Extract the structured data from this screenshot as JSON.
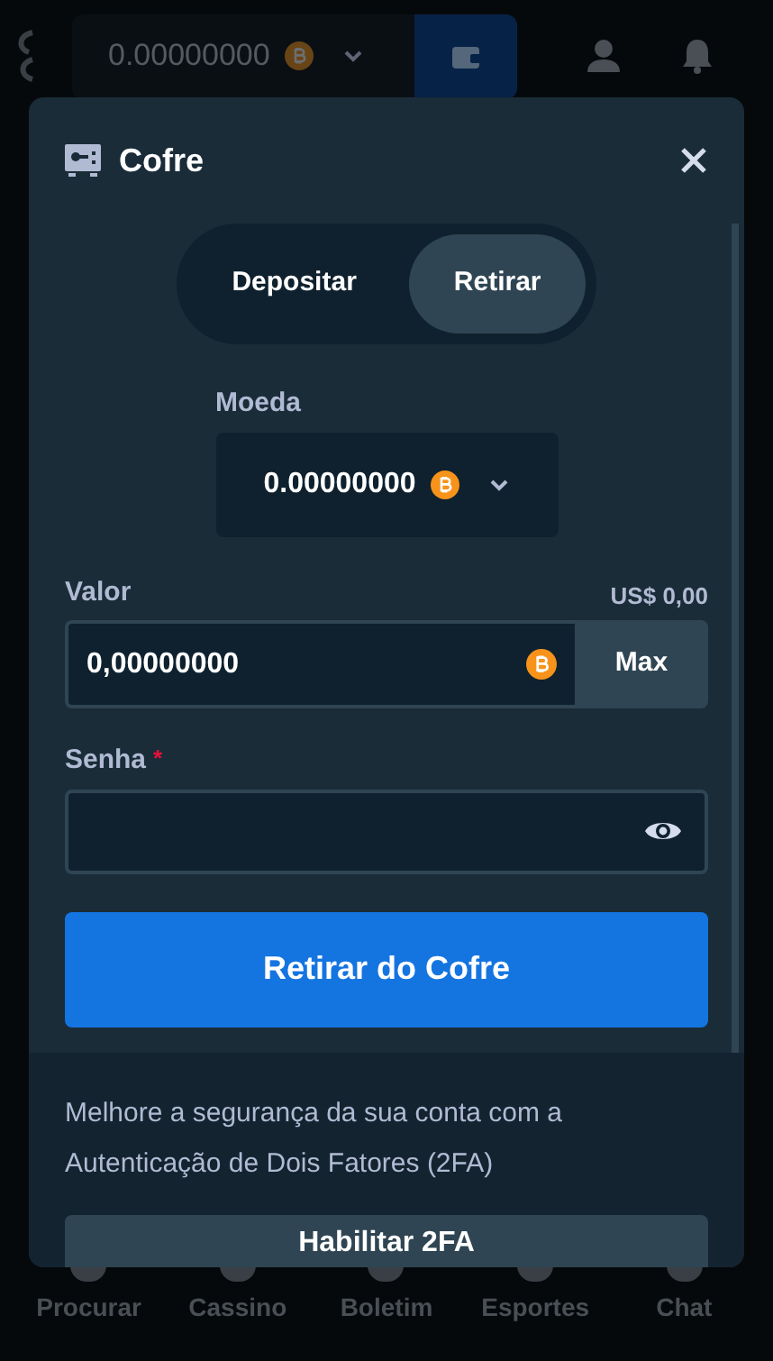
{
  "header": {
    "balance": "0.00000000"
  },
  "modal": {
    "title": "Cofre",
    "tabs": [
      {
        "label": "Depositar",
        "selected": false
      },
      {
        "label": "Retirar",
        "selected": true
      }
    ],
    "currency": {
      "label": "Moeda",
      "value": "0.00000000"
    },
    "amount": {
      "label": "Valor",
      "usd": "US$ 0,00",
      "value": "0,00000000",
      "max_button": "Max"
    },
    "password": {
      "label": "Senha",
      "required_mark": "*"
    },
    "submit": "Retirar do Cofre",
    "twofa": {
      "text": "Melhore a segurança da sua conta com a Autenticação de Dois Fatores (2FA)",
      "button": "Habilitar 2FA"
    }
  },
  "bottom_nav": [
    {
      "label": "Procurar"
    },
    {
      "label": "Cassino"
    },
    {
      "label": "Boletim"
    },
    {
      "label": "Esportes"
    },
    {
      "label": "Chat"
    }
  ]
}
